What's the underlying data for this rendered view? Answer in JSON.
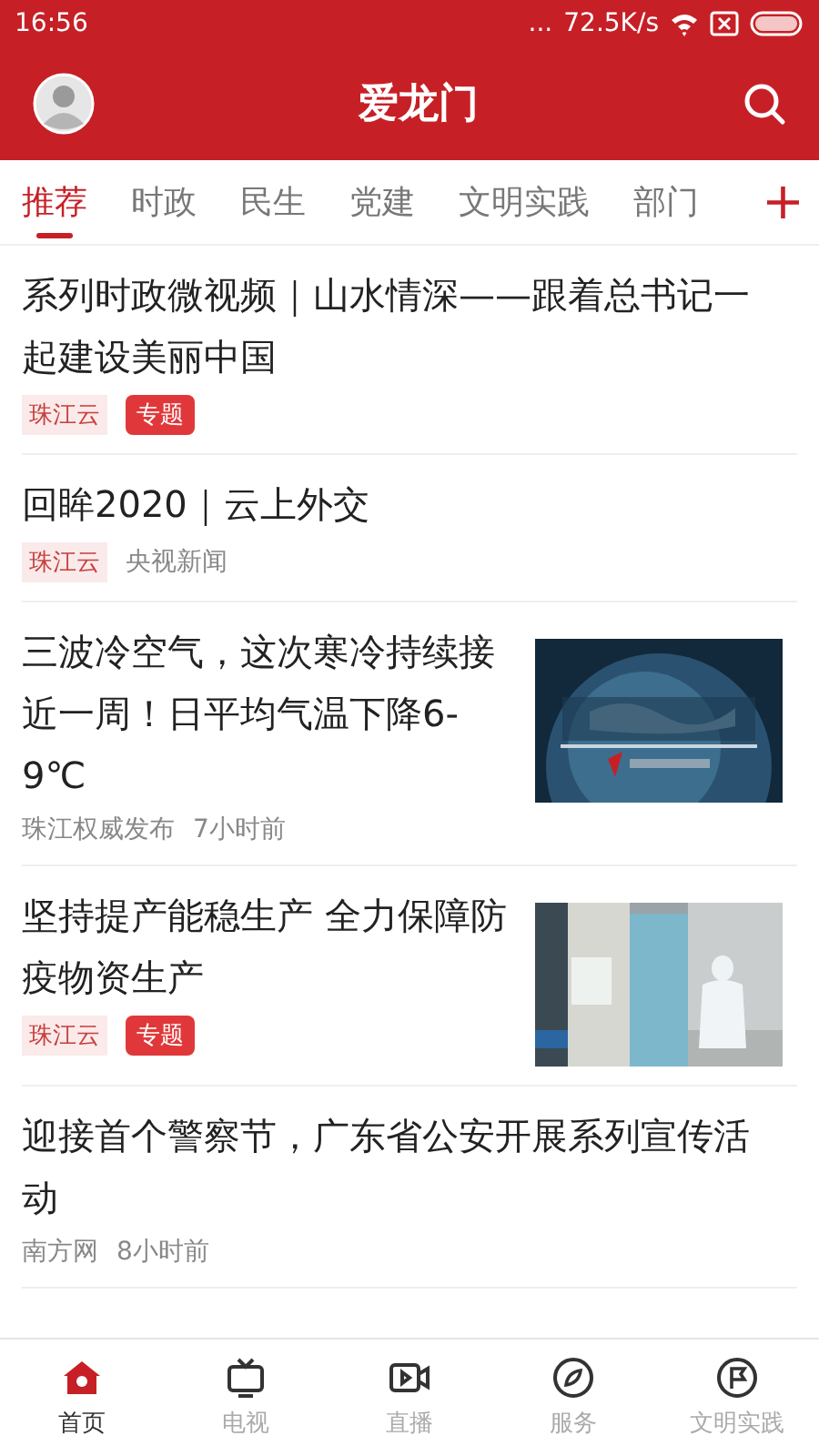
{
  "status_bar": {
    "time": "16:56",
    "dots": "...",
    "speed": "72.5K/s"
  },
  "header": {
    "title": "爱龙门"
  },
  "tabs": [
    {
      "label": "推荐",
      "selected": true
    },
    {
      "label": "时政",
      "selected": false
    },
    {
      "label": "民生",
      "selected": false
    },
    {
      "label": "党建",
      "selected": false
    },
    {
      "label": "文明实践",
      "selected": false
    },
    {
      "label": "部门",
      "selected": false
    }
  ],
  "add_tab": "+",
  "articles": [
    {
      "title": "系列时政微视频｜山水情深——跟着总书记一起建设美丽中国",
      "meta": [
        {
          "kind": "source_tag",
          "text": "珠江云"
        },
        {
          "kind": "special_tag",
          "text": "专题"
        }
      ]
    },
    {
      "title": "回眸2020｜云上外交",
      "meta": [
        {
          "kind": "source_tag",
          "text": "珠江云"
        },
        {
          "kind": "plain",
          "text": "央视新闻"
        }
      ]
    },
    {
      "title": "三波冷空气，这次寒冷持续接近一周！日平均气温下降6-9℃",
      "meta": [
        {
          "kind": "plain",
          "text": "珠江权威发布"
        },
        {
          "kind": "plain",
          "text": "7小时前"
        }
      ]
    },
    {
      "title": "坚持提产能稳生产 全力保障防疫物资生产",
      "meta": [
        {
          "kind": "source_tag",
          "text": "珠江云"
        },
        {
          "kind": "special_tag",
          "text": "专题"
        }
      ]
    },
    {
      "title": "迎接首个警察节，广东省公安开展系列宣传活动",
      "meta": [
        {
          "kind": "plain",
          "text": "南方网"
        },
        {
          "kind": "plain",
          "text": "8小时前"
        }
      ]
    }
  ],
  "bottom_nav": [
    {
      "label": "首页",
      "kind": "home",
      "selected": true
    },
    {
      "label": "电视",
      "kind": "tv",
      "selected": false
    },
    {
      "label": "直播",
      "kind": "video",
      "selected": false
    },
    {
      "label": "服务",
      "kind": "compass",
      "selected": false
    },
    {
      "label": "文明实践",
      "kind": "flag",
      "selected": false
    }
  ]
}
